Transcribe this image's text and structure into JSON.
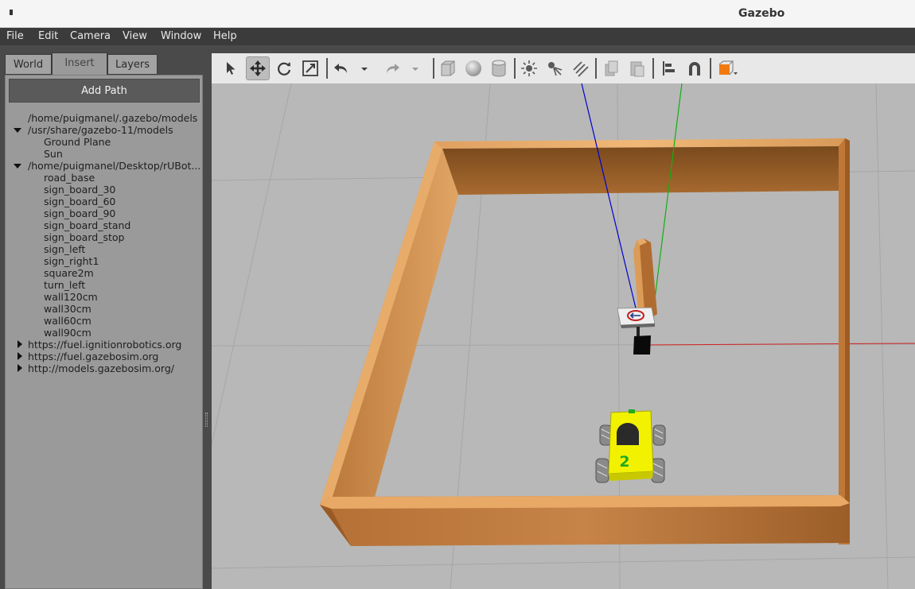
{
  "window": {
    "title": "Gazebo"
  },
  "menu": [
    "File",
    "Edit",
    "Camera",
    "View",
    "Window",
    "Help"
  ],
  "tabs": {
    "world": "World",
    "insert": "Insert",
    "layers": "Layers"
  },
  "insert": {
    "add_path": "Add Path",
    "paths": [
      {
        "label": "/home/puigmanel/.gazebo/models",
        "expanded": null,
        "items": []
      },
      {
        "label": "/usr/share/gazebo-11/models",
        "expanded": true,
        "items": [
          "Ground Plane",
          "Sun"
        ]
      },
      {
        "label": "/home/puigmanel/Desktop/rUBot...",
        "expanded": true,
        "items": [
          "road_base",
          "sign_board_30",
          "sign_board_60",
          "sign_board_90",
          "sign_board_stand",
          "sign_board_stop",
          "sign_left",
          "sign_right1",
          "square2m",
          "turn_left",
          "wall120cm",
          "wall30cm",
          "wall60cm",
          "wall90cm"
        ]
      },
      {
        "label": "https://fuel.ignitionrobotics.org",
        "expanded": false,
        "items": []
      },
      {
        "label": "https://fuel.gazebosim.org",
        "expanded": false,
        "items": []
      },
      {
        "label": "http://models.gazebosim.org/",
        "expanded": false,
        "items": []
      }
    ]
  },
  "toolbar": {
    "tools": [
      "select-arrow-icon",
      "translate-icon",
      "rotate-icon",
      "scale-icon",
      "undo-icon",
      "undo-history-icon",
      "redo-icon",
      "redo-history-icon",
      "box-icon",
      "sphere-icon",
      "cylinder-icon",
      "point-light-icon",
      "spot-light-icon",
      "directional-light-icon",
      "copy-icon",
      "paste-icon",
      "align-icon",
      "snap-icon",
      "view-angle-icon"
    ],
    "active_tool": "translate-icon"
  },
  "scene": {
    "robot_number": "2",
    "colors": {
      "ground": "#b8b8b8",
      "wood": "#c98a45",
      "robot": "#f2f200",
      "axis_x": "#d02020",
      "axis_y": "#10b010",
      "axis_z": "#0000d0"
    }
  }
}
